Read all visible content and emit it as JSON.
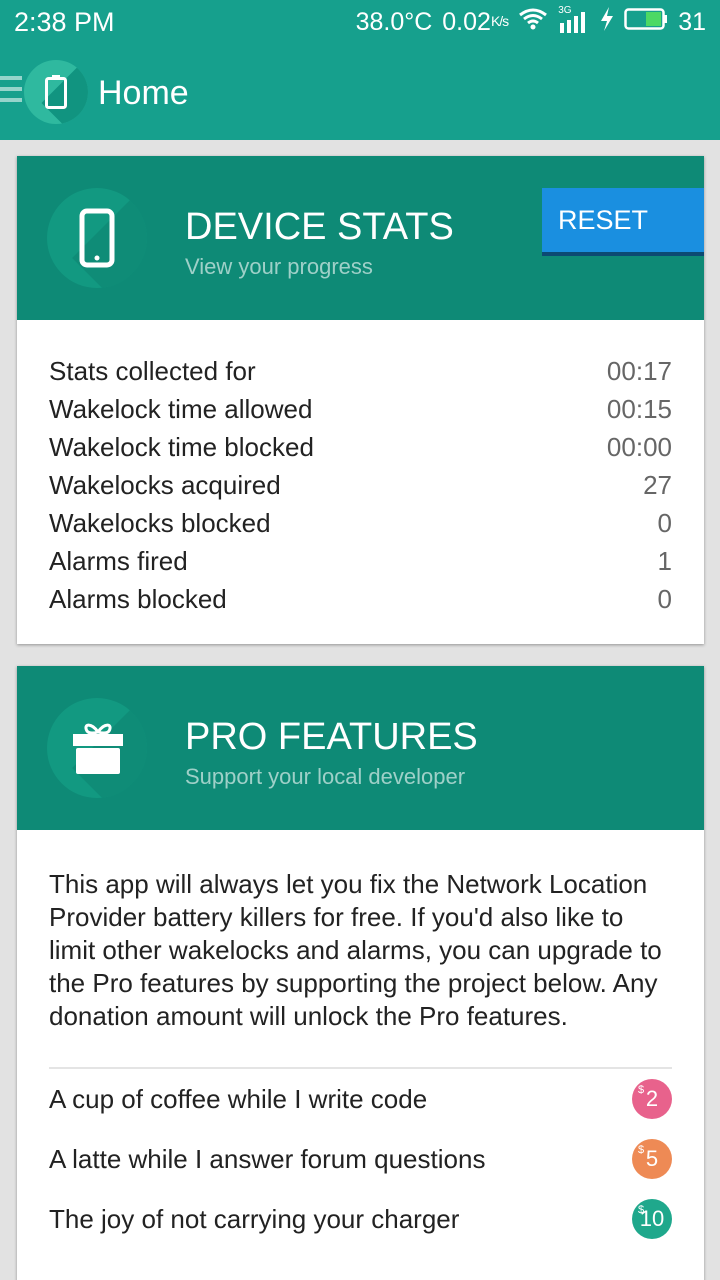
{
  "status_bar": {
    "time": "2:38 PM",
    "temperature": "38.0°C",
    "net_speed": "0.02",
    "net_speed_unit": "K/s",
    "signal_label": "3G",
    "battery": "31"
  },
  "app_bar": {
    "title": "Home"
  },
  "device_stats": {
    "title": "DEVICE STATS",
    "subtitle": "View your progress",
    "reset_label": "RESET",
    "rows": [
      {
        "label": "Stats collected for",
        "value": "00:17"
      },
      {
        "label": "Wakelock time allowed",
        "value": "00:15"
      },
      {
        "label": "Wakelock time blocked",
        "value": "00:00"
      },
      {
        "label": "Wakelocks acquired",
        "value": "27"
      },
      {
        "label": "Wakelocks blocked",
        "value": "0"
      },
      {
        "label": "Alarms fired",
        "value": "1"
      },
      {
        "label": "Alarms blocked",
        "value": "0"
      }
    ]
  },
  "pro_features": {
    "title": "PRO FEATURES",
    "subtitle": "Support your local developer",
    "description": "This app will always let you fix the Network Location Provider battery killers for free.  If you'd also like to limit other wakelocks and alarms, you can upgrade to the Pro features by supporting the project below.  Any donation amount will unlock the Pro features.",
    "donations": [
      {
        "label": "A cup of coffee while I write code",
        "currency": "$",
        "amount": "2",
        "color": "#e8628c"
      },
      {
        "label": "A latte while I answer forum questions",
        "currency": "$",
        "amount": "5",
        "color": "#ee8a55"
      },
      {
        "label": "The joy of not carrying your charger",
        "currency": "$",
        "amount": "10",
        "color": "#1fa88c"
      }
    ]
  },
  "colors": {
    "primary": "#16a08d",
    "card_header": "#0e8a76",
    "accent": "#1a8fe0"
  }
}
